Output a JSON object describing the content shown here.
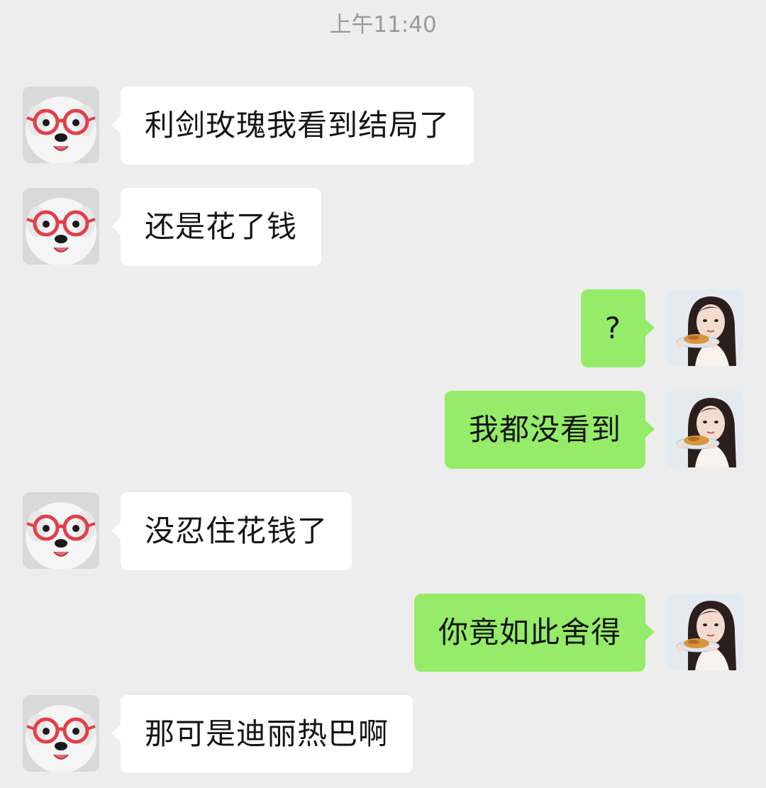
{
  "chat": {
    "timestamp": "上午11:40",
    "messages": [
      {
        "sender": "friend",
        "text": "利剑玫瑰我看到结局了"
      },
      {
        "sender": "friend",
        "text": "还是花了钱"
      },
      {
        "sender": "me",
        "text": "?"
      },
      {
        "sender": "me",
        "text": "我都没看到"
      },
      {
        "sender": "friend",
        "text": "没忍住花钱了"
      },
      {
        "sender": "me",
        "text": "你竟如此舍得"
      },
      {
        "sender": "friend",
        "text": "那可是迪丽热巴啊"
      }
    ]
  },
  "avatars": {
    "friend_icon": "dog-with-red-glasses-avatar",
    "me_icon": "woman-holding-food-avatar"
  },
  "colors": {
    "background": "#ededed",
    "incoming_bubble": "#ffffff",
    "outgoing_bubble": "#95ec69",
    "timestamp": "#9a9a9a",
    "text": "#151515"
  }
}
